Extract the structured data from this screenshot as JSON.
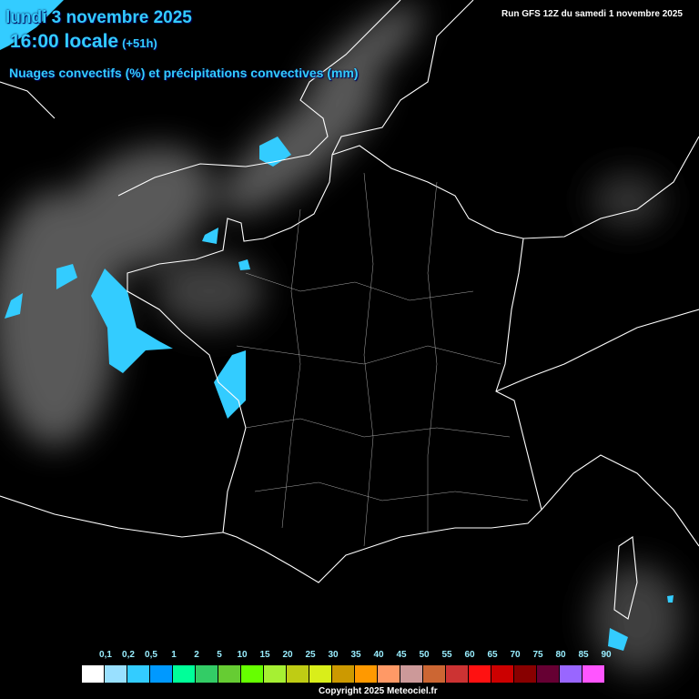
{
  "header": {
    "date": "lundi 3 novembre 2025",
    "time": "16:00 locale",
    "lead": "(+51h)",
    "parameter": "Nuages convectifs (%) et précipitations convectives (mm)",
    "run": "Run GFS 12Z du samedi 1 novembre 2025"
  },
  "legend": {
    "labels": [
      "0,1",
      "0,2",
      "0,5",
      "1",
      "2",
      "5",
      "10",
      "15",
      "20",
      "25",
      "30",
      "35",
      "40",
      "45",
      "50",
      "55",
      "60",
      "65",
      "70",
      "75",
      "80",
      "85",
      "90"
    ],
    "colors": [
      "#ffffff",
      "#99e0ff",
      "#33ccff",
      "#0099ff",
      "#00ff99",
      "#33cc66",
      "#66cc33",
      "#66ff00",
      "#a6f033",
      "#bfcc14",
      "#d9ee1a",
      "#cc9900",
      "#ff9900",
      "#ff9966",
      "#cc9999",
      "#cc6633",
      "#cc3333",
      "#ff1111",
      "#cc0000",
      "#880000",
      "#660033",
      "#9966ff",
      "#ff55ff"
    ]
  },
  "footer": {
    "copyright": "Copyright 2025 Meteociel.fr"
  }
}
